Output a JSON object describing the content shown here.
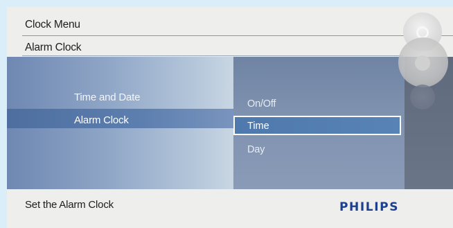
{
  "header": {
    "menu_title": "Clock Menu",
    "submenu_title": "Alarm Clock"
  },
  "left_menu": {
    "items": [
      "Time and Date",
      "Alarm Clock"
    ],
    "selected_index": 1
  },
  "right_menu": {
    "items": [
      "On/Off",
      "Time",
      "Day"
    ],
    "selected_index": 1
  },
  "footer": {
    "hint": "Set the Alarm Clock",
    "brand": "PHILIPS"
  },
  "colors": {
    "brand": "#1d3f8f",
    "highlight": "#5883b6"
  },
  "icons": [
    "control-button-icon",
    "navigation-button-icon",
    "back-button-icon"
  ]
}
